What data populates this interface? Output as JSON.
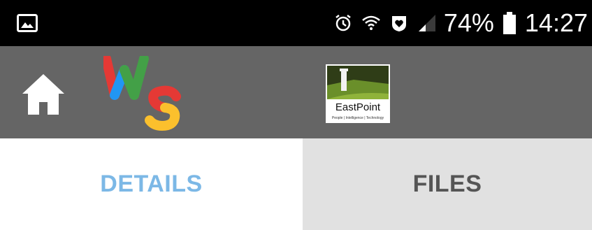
{
  "status_bar": {
    "left_icon": "image-notification-icon",
    "icons": [
      "alarm-icon",
      "wifi-icon",
      "heart-shield-icon",
      "cellular-signal-icon"
    ],
    "battery_percent": "74%",
    "battery_icon": "battery-icon",
    "time": "14:27"
  },
  "app_bar": {
    "home_icon": "home-icon",
    "app_logo": {
      "name": "ws-logo",
      "letters": [
        "W",
        "S"
      ],
      "colors": [
        "#e53935",
        "#2196f3",
        "#43a047",
        "#fbc02d"
      ]
    },
    "partner_logo": {
      "name": "eastpoint-logo",
      "title": "EastPoint",
      "tagline": "People | Intelligence | Technology"
    },
    "background": "#656565"
  },
  "tabs": [
    {
      "label": "DETAILS",
      "active": true
    },
    {
      "label": "FILES",
      "active": false
    }
  ],
  "colors": {
    "active_tab_text": "#7cb8e6",
    "inactive_tab_bg": "#e1e1e1"
  }
}
